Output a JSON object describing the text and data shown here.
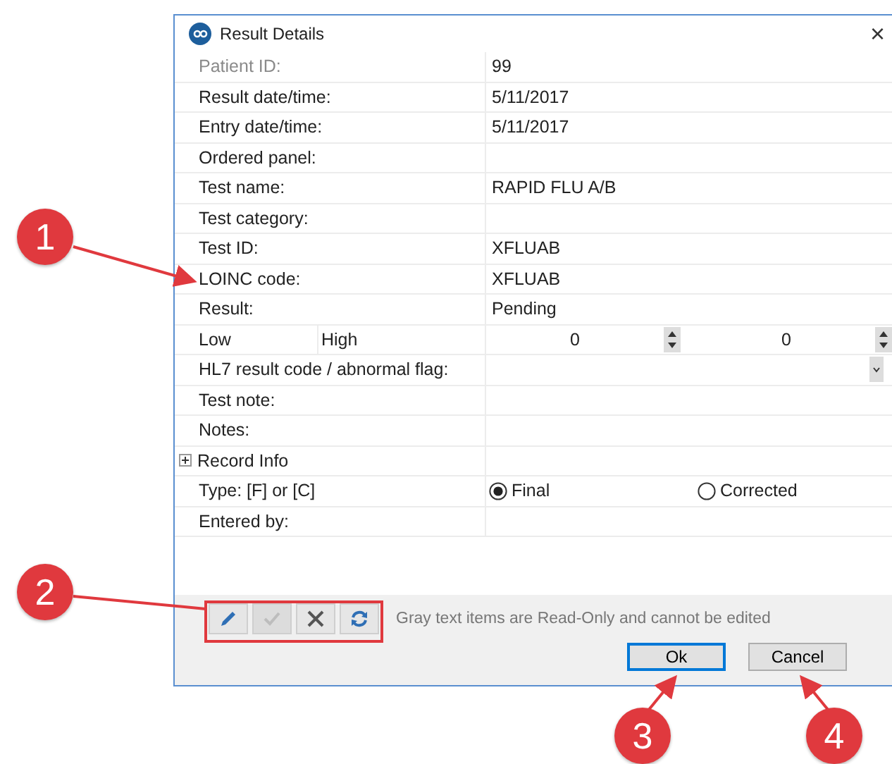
{
  "window": {
    "title": "Result Details",
    "close": "×"
  },
  "rows": [
    {
      "kind": "text",
      "label": "Patient ID:",
      "value": "99",
      "read_only": true
    },
    {
      "kind": "text",
      "label": "Result date/time:",
      "value": "5/11/2017",
      "read_only": false
    },
    {
      "kind": "text",
      "label": "Entry date/time:",
      "value": "5/11/2017",
      "read_only": false
    },
    {
      "kind": "text",
      "label": "Ordered panel:",
      "read_only": false
    },
    {
      "kind": "text",
      "label": "Test name:",
      "value": "RAPID FLU A/B",
      "read_only": false
    },
    {
      "kind": "text",
      "label": "Test category:",
      "read_only": false
    },
    {
      "kind": "text",
      "label": "Test ID:",
      "value": "XFLUAB",
      "read_only": false
    },
    {
      "kind": "text",
      "label": "LOINC code:",
      "value": "XFLUAB",
      "read_only": false
    },
    {
      "kind": "text",
      "label": "Result:",
      "value": "Pending",
      "read_only": false
    },
    {
      "kind": "range",
      "label": "Low",
      "label_2": "High",
      "low": "0",
      "high": "0"
    },
    {
      "kind": "dropdown",
      "label": "HL7 result code / abnormal flag:"
    },
    {
      "kind": "text",
      "label": "Test note:",
      "read_only": false
    },
    {
      "kind": "text",
      "label": "Notes:",
      "read_only": false
    },
    {
      "kind": "group",
      "label": "Record Info",
      "expanded": false
    },
    {
      "kind": "radio",
      "label": "Type: [F] or [C]",
      "options": [
        {
          "label": "Final",
          "selected": true
        },
        {
          "label": "Corrected",
          "selected": false
        }
      ]
    },
    {
      "kind": "text",
      "label": "Entered by:",
      "read_only": false
    }
  ],
  "toolbar": [
    {
      "kind": "edit",
      "disabled": false
    },
    {
      "kind": "accept",
      "disabled": true
    },
    {
      "kind": "cancel",
      "disabled": false
    },
    {
      "kind": "refresh",
      "disabled": false
    }
  ],
  "hint": "Gray text items are Read-Only and cannot be edited",
  "buttons": [
    {
      "label": "Ok",
      "default": true
    },
    {
      "label": "Cancel",
      "default": false
    }
  ],
  "callouts": [
    {
      "label": "1"
    },
    {
      "label": "2"
    },
    {
      "label": "3"
    },
    {
      "label": "4"
    }
  ]
}
